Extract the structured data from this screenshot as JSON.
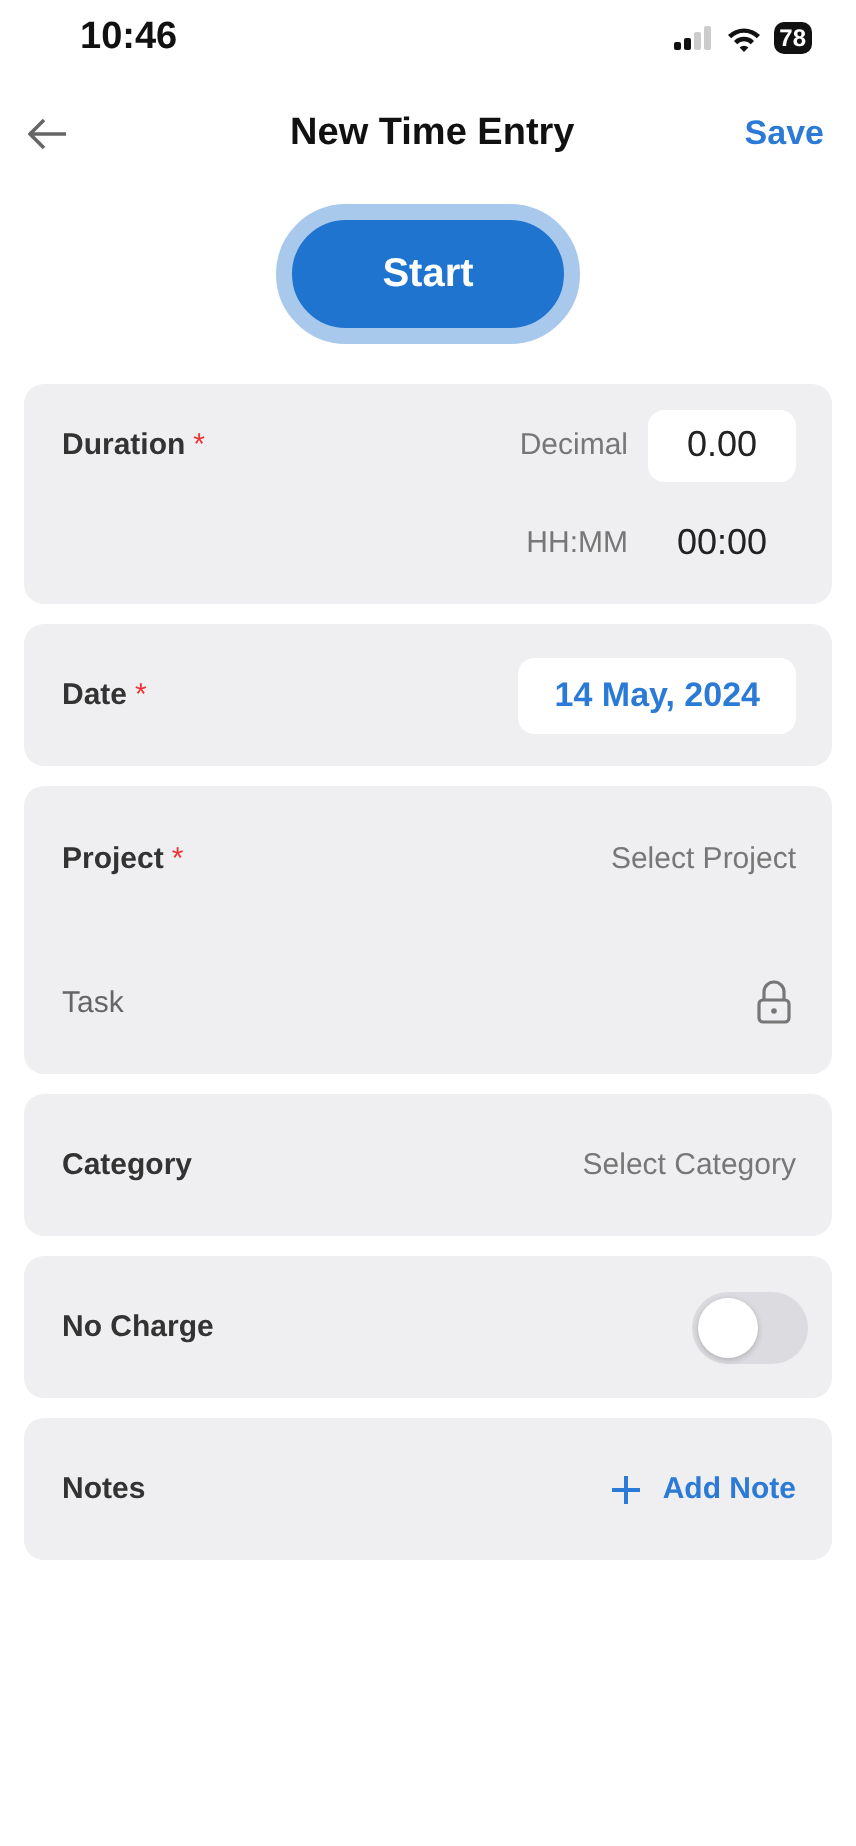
{
  "status_bar": {
    "time": "10:46",
    "battery": "78"
  },
  "nav": {
    "title": "New Time Entry",
    "action": "Save"
  },
  "start_button": {
    "label": "Start"
  },
  "cards": [
    {
      "kind": "duration",
      "label": "Duration",
      "required_mark": "*",
      "rows": [
        {
          "label": "Decimal",
          "value": "0.00",
          "boxed": true
        },
        {
          "label": "HH:MM",
          "value": "00:00",
          "boxed": false
        }
      ]
    },
    {
      "kind": "date",
      "label": "Date",
      "required_mark": "*",
      "value": "14 May, 2024"
    },
    {
      "kind": "project",
      "label": "Project",
      "required_mark": "*",
      "prompt": "Select Project",
      "task_label": "Task",
      "task_locked": true
    },
    {
      "kind": "select",
      "label": "Category",
      "prompt": "Select Category"
    },
    {
      "kind": "toggle",
      "label": "No Charge",
      "on": false
    },
    {
      "kind": "add",
      "label": "Notes",
      "action": "Add Note"
    }
  ]
}
